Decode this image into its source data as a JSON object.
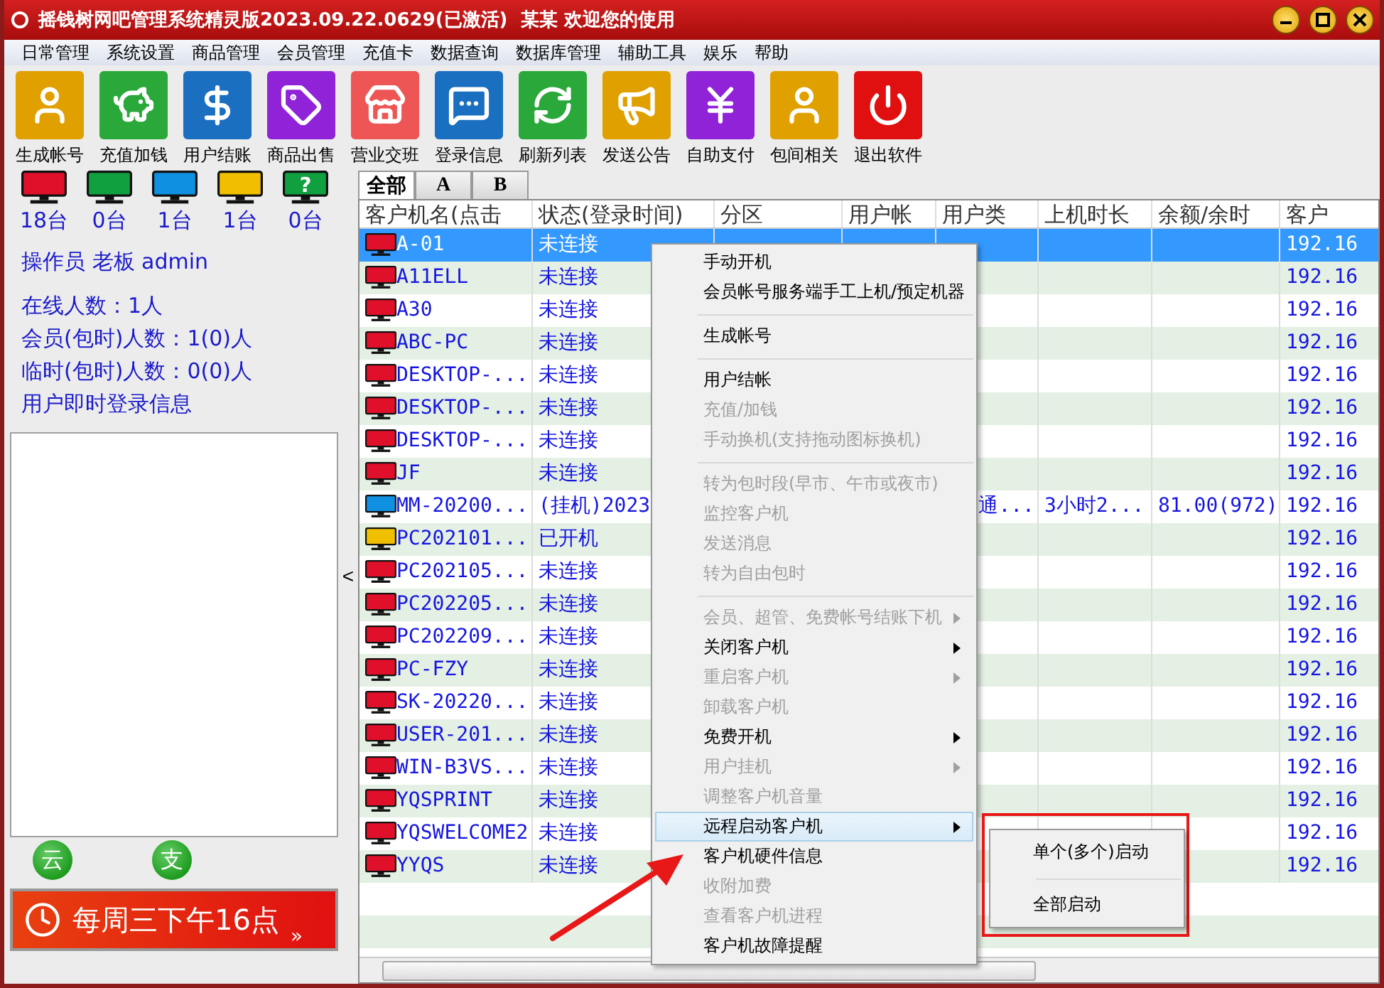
{
  "window": {
    "title": "摇钱树网吧管理系统精灵版2023.09.22.0629(已激活)  某某 欢迎您的使用"
  },
  "menu_bar": [
    "日常管理",
    "系统设置",
    "商品管理",
    "会员管理",
    "充值卡",
    "数据查询",
    "数据库管理",
    "辅助工具",
    "娱乐",
    "帮助"
  ],
  "toolbar": [
    {
      "label": "生成帐号",
      "color": "#e0a000"
    },
    {
      "label": "充值加钱",
      "color": "#2aa83a"
    },
    {
      "label": "用户结账",
      "color": "#1a6fc0"
    },
    {
      "label": "商品出售",
      "color": "#9022d8"
    },
    {
      "label": "营业交班",
      "color": "#ee5555"
    },
    {
      "label": "登录信息",
      "color": "#1a6fc0"
    },
    {
      "label": "刷新列表",
      "color": "#2aa83a"
    },
    {
      "label": "发送公告",
      "color": "#e0a000"
    },
    {
      "label": "自助支付",
      "color": "#9022d8"
    },
    {
      "label": "包间相关",
      "color": "#e0a000"
    },
    {
      "label": "退出软件",
      "color": "#e01010"
    }
  ],
  "status_counts": [
    {
      "count": "18台",
      "color": "#e0102a"
    },
    {
      "count": "0台",
      "color": "#10a040"
    },
    {
      "count": "1台",
      "color": "#1090e0"
    },
    {
      "count": "1台",
      "color": "#f0c000"
    },
    {
      "count": "0台",
      "color": "#10a040",
      "glyph": "?"
    }
  ],
  "info": {
    "operator": "操作员 老板 admin",
    "lines": [
      "在线人数：1人",
      "会员(包时)人数：1(0)人",
      "临时(包时)人数：0(0)人",
      "用户即时登录信息"
    ]
  },
  "side_buttons": [
    "云",
    "支"
  ],
  "banner": {
    "text": "每周三下午16点",
    "more": "»"
  },
  "collapse": "<",
  "tabs": [
    {
      "label": "全部",
      "selected": true
    },
    {
      "label": "A",
      "selected": false
    },
    {
      "label": "B",
      "selected": false
    }
  ],
  "table": {
    "columns": [
      "客户机名(点击",
      "状态(登录时间)",
      "分区",
      "用户帐",
      "用户类",
      "上机时长",
      "余额/余时",
      "客户"
    ],
    "rows": [
      {
        "selected": true,
        "color": "#e0102a",
        "cells": [
          "A-01",
          "未连接",
          "",
          "",
          "",
          "",
          "",
          "192.16"
        ]
      },
      {
        "selected": false,
        "color": "#e0102a",
        "cells": [
          "A11ELL",
          "未连接",
          "",
          "",
          "",
          "",
          "",
          "192.16"
        ]
      },
      {
        "selected": false,
        "color": "#e0102a",
        "cells": [
          "A30",
          "未连接",
          "",
          "",
          "",
          "",
          "",
          "192.16"
        ]
      },
      {
        "selected": false,
        "color": "#e0102a",
        "cells": [
          "ABC-PC",
          "未连接",
          "",
          "",
          "",
          "",
          "",
          "192.16"
        ]
      },
      {
        "selected": false,
        "color": "#e0102a",
        "cells": [
          "DESKTOP-...",
          "未连接",
          "",
          "",
          "",
          "",
          "",
          "192.16"
        ]
      },
      {
        "selected": false,
        "color": "#e0102a",
        "cells": [
          "DESKTOP-...",
          "未连接",
          "",
          "",
          "",
          "",
          "",
          "192.16"
        ]
      },
      {
        "selected": false,
        "color": "#e0102a",
        "cells": [
          "DESKTOP-...",
          "未连接",
          "",
          "",
          "",
          "",
          "",
          "192.16"
        ]
      },
      {
        "selected": false,
        "color": "#e0102a",
        "cells": [
          "JF",
          "未连接",
          "",
          "",
          "",
          "",
          "",
          "192.16"
        ]
      },
      {
        "selected": false,
        "color": "#1090e0",
        "cells": [
          "MM-20200...",
          "(挂机)2023",
          "",
          "",
          "通...",
          "3小时2...",
          "81.00(972)",
          "192.16"
        ]
      },
      {
        "selected": false,
        "color": "#f0c000",
        "cells": [
          "PC202101...",
          "已开机",
          "",
          "",
          "",
          "",
          "",
          "192.16"
        ]
      },
      {
        "selected": false,
        "color": "#e0102a",
        "cells": [
          "PC202105...",
          "未连接",
          "",
          "",
          "",
          "",
          "",
          "192.16"
        ]
      },
      {
        "selected": false,
        "color": "#e0102a",
        "cells": [
          "PC202205...",
          "未连接",
          "",
          "",
          "",
          "",
          "",
          "192.16"
        ]
      },
      {
        "selected": false,
        "color": "#e0102a",
        "cells": [
          "PC202209...",
          "未连接",
          "",
          "",
          "",
          "",
          "",
          "192.16"
        ]
      },
      {
        "selected": false,
        "color": "#e0102a",
        "cells": [
          "PC-FZY",
          "未连接",
          "",
          "",
          "",
          "",
          "",
          "192.16"
        ]
      },
      {
        "selected": false,
        "color": "#e0102a",
        "cells": [
          "SK-20220...",
          "未连接",
          "",
          "",
          "",
          "",
          "",
          "192.16"
        ]
      },
      {
        "selected": false,
        "color": "#e0102a",
        "cells": [
          "USER-201...",
          "未连接",
          "",
          "",
          "",
          "",
          "",
          "192.16"
        ]
      },
      {
        "selected": false,
        "color": "#e0102a",
        "cells": [
          "WIN-B3VS...",
          "未连接",
          "",
          "",
          "",
          "",
          "",
          "192.16"
        ]
      },
      {
        "selected": false,
        "color": "#e0102a",
        "cells": [
          "YQSPRINT",
          "未连接",
          "",
          "",
          "",
          "",
          "",
          "192.16"
        ]
      },
      {
        "selected": false,
        "color": "#e0102a",
        "cells": [
          "YQSWELCOME2",
          "未连接",
          "",
          "",
          "",
          "",
          "",
          "192.16"
        ]
      },
      {
        "selected": false,
        "color": "#e0102a",
        "cells": [
          "YYQS",
          "未连接",
          "",
          "",
          "",
          "",
          "",
          "192.16"
        ]
      }
    ]
  },
  "context_menu": [
    {
      "kind": "item",
      "label": "手动开机",
      "disabled": false,
      "submenu": false,
      "selected": false
    },
    {
      "kind": "item",
      "label": "会员帐号服务端手工上机/预定机器",
      "disabled": false,
      "submenu": false,
      "selected": false
    },
    {
      "kind": "separator"
    },
    {
      "kind": "item",
      "label": "生成帐号",
      "disabled": false,
      "submenu": false,
      "selected": false
    },
    {
      "kind": "separator"
    },
    {
      "kind": "item",
      "label": "用户结帐",
      "disabled": false,
      "submenu": false,
      "selected": false
    },
    {
      "kind": "item",
      "label": "充值/加钱",
      "disabled": true,
      "submenu": false,
      "selected": false
    },
    {
      "kind": "item",
      "label": "手动换机(支持拖动图标换机)",
      "disabled": true,
      "submenu": false,
      "selected": false
    },
    {
      "kind": "separator"
    },
    {
      "kind": "item",
      "label": "转为包时段(早市、午市或夜市)",
      "disabled": true,
      "submenu": false,
      "selected": false
    },
    {
      "kind": "item",
      "label": "监控客户机",
      "disabled": true,
      "submenu": false,
      "selected": false
    },
    {
      "kind": "item",
      "label": "发送消息",
      "disabled": true,
      "submenu": false,
      "selected": false
    },
    {
      "kind": "item",
      "label": "转为自由包时",
      "disabled": true,
      "submenu": false,
      "selected": false
    },
    {
      "kind": "separator"
    },
    {
      "kind": "item",
      "label": "会员、超管、免费帐号结账下机",
      "disabled": true,
      "submenu": true,
      "selected": false
    },
    {
      "kind": "item",
      "label": "关闭客户机",
      "disabled": false,
      "submenu": true,
      "selected": false
    },
    {
      "kind": "item",
      "label": "重启客户机",
      "disabled": true,
      "submenu": true,
      "selected": false
    },
    {
      "kind": "item",
      "label": "卸载客户机",
      "disabled": true,
      "submenu": false,
      "selected": false
    },
    {
      "kind": "item",
      "label": "免费开机",
      "disabled": false,
      "submenu": true,
      "selected": false
    },
    {
      "kind": "item",
      "label": "用户挂机",
      "disabled": true,
      "submenu": true,
      "selected": false
    },
    {
      "kind": "item",
      "label": "调整客户机音量",
      "disabled": true,
      "submenu": false,
      "selected": false
    },
    {
      "kind": "item",
      "label": "远程启动客户机",
      "disabled": false,
      "submenu": true,
      "selected": true
    },
    {
      "kind": "item",
      "label": "客户机硬件信息",
      "disabled": false,
      "submenu": false,
      "selected": false
    },
    {
      "kind": "item",
      "label": "收附加费",
      "disabled": true,
      "submenu": false,
      "selected": false
    },
    {
      "kind": "item",
      "label": "查看客户机进程",
      "disabled": true,
      "submenu": false,
      "selected": false
    },
    {
      "kind": "item",
      "label": "客户机故障提醒",
      "disabled": false,
      "submenu": false,
      "selected": false
    }
  ],
  "submenu": [
    "单个(多个)启动",
    "全部启动"
  ]
}
